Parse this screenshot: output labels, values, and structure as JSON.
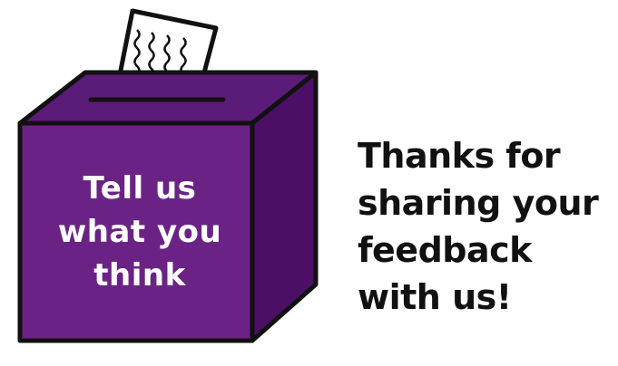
{
  "illustration": {
    "icon": "ballot-box-icon",
    "paper_icon": "ballot-paper-icon",
    "box_front_color": "#6a2385",
    "box_top_color": "#5b1b78",
    "box_side_color": "#4b1065",
    "outline_color": "#111111",
    "paper_color": "#ffffff"
  },
  "box_label": {
    "line1": "Tell us",
    "line2": "what you",
    "line3": "think"
  },
  "message": {
    "line1": "Thanks for",
    "line2": "sharing your",
    "line3": "feedback",
    "line4": "with us!"
  }
}
